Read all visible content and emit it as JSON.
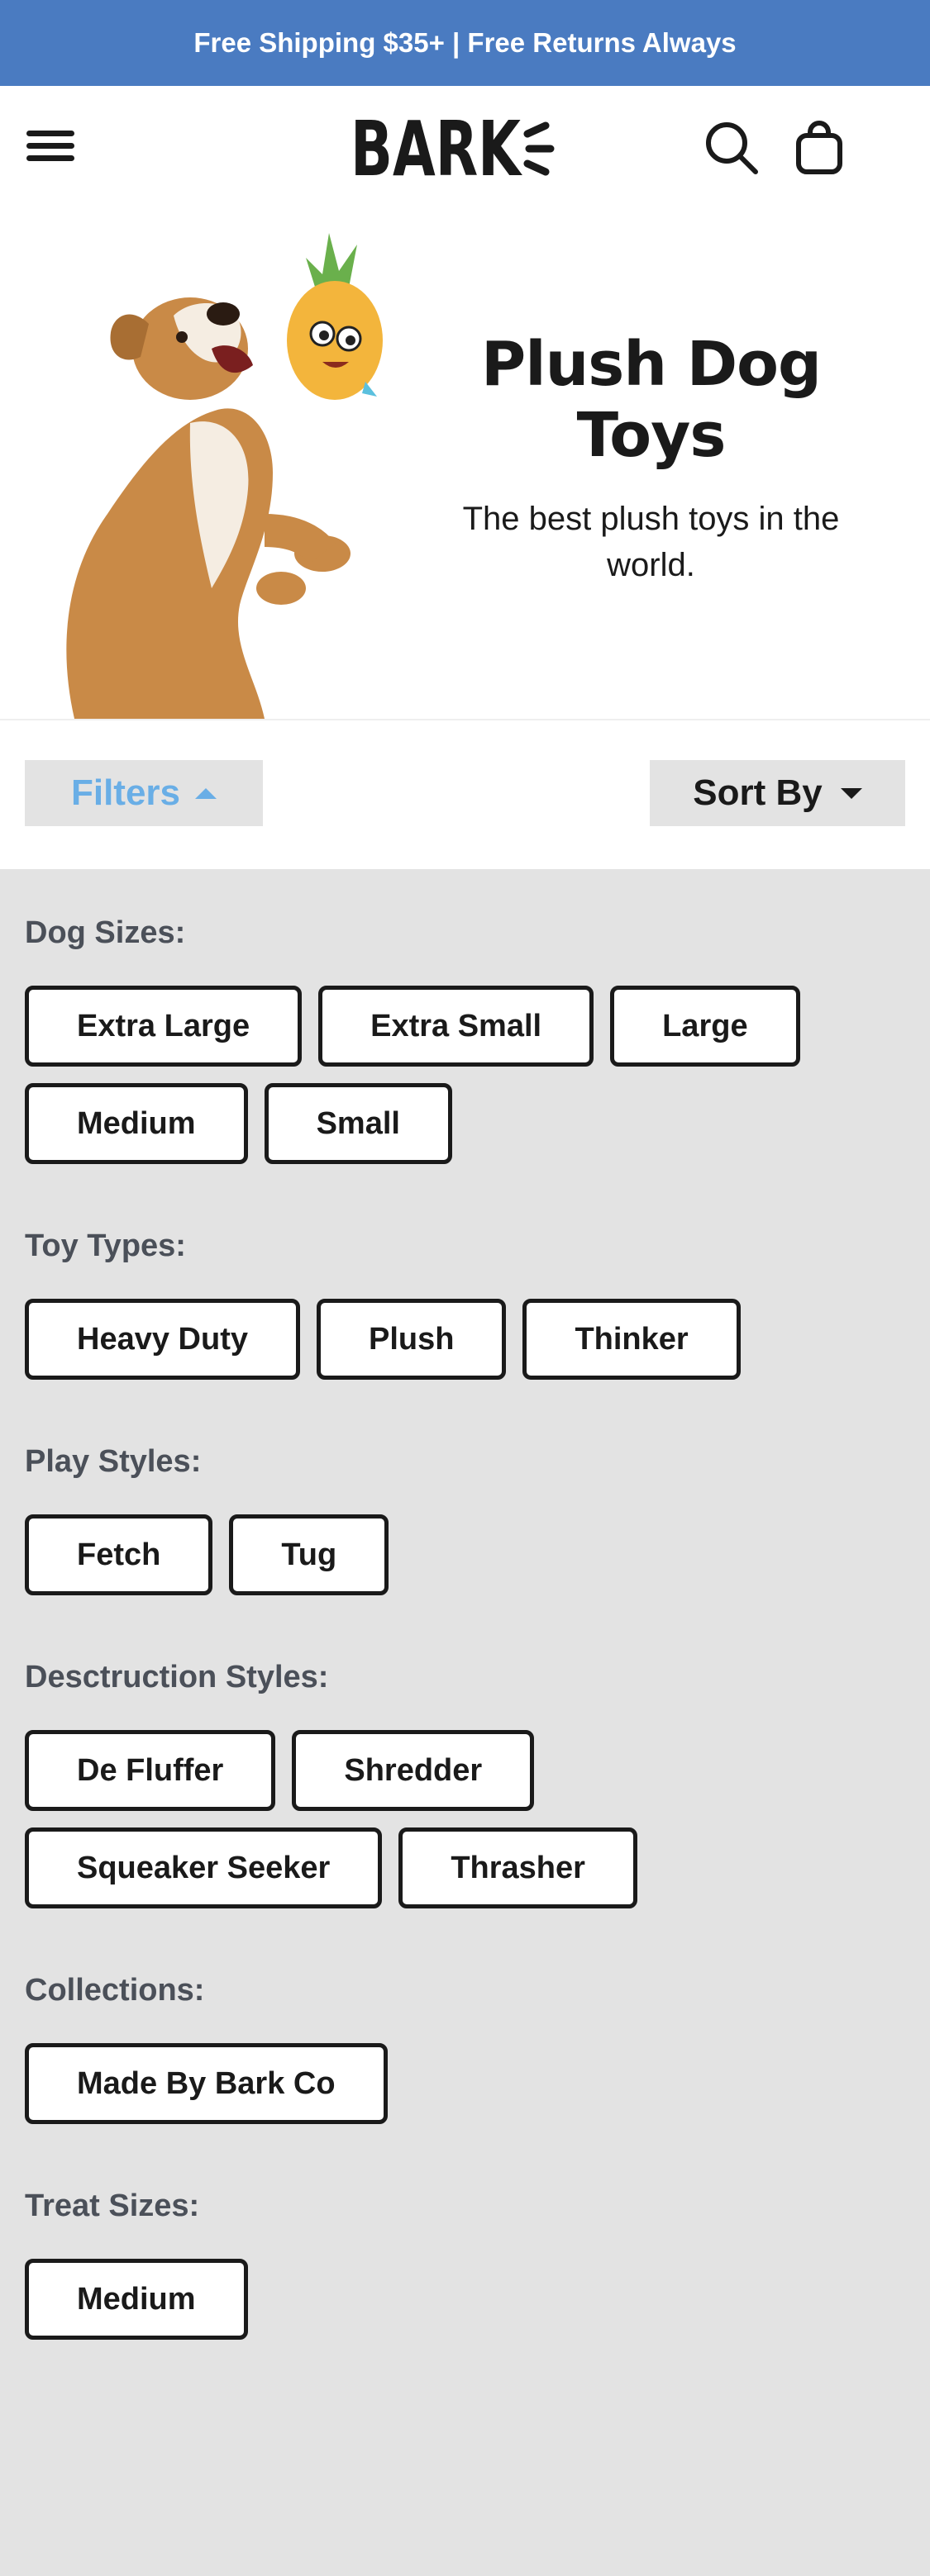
{
  "promo": {
    "text": "Free Shipping $35+ | Free Returns Always"
  },
  "header": {
    "logo_text": "BARK"
  },
  "hero": {
    "title_line1": "Plush Dog",
    "title_line2": "Toys",
    "subtitle_line1": "The best plush toys in the",
    "subtitle_line2": "world."
  },
  "controls": {
    "filters_label": "Filters",
    "sort_label": "Sort By"
  },
  "filters": {
    "groups": [
      {
        "title": "Dog Sizes:",
        "options": [
          "Extra Large",
          "Extra Small",
          "Large",
          "Medium",
          "Small"
        ]
      },
      {
        "title": "Toy Types:",
        "options": [
          "Heavy Duty",
          "Plush",
          "Thinker"
        ]
      },
      {
        "title": "Play Styles:",
        "options": [
          "Fetch",
          "Tug"
        ]
      },
      {
        "title": "Desctruction Styles:",
        "options": [
          "De Fluffer",
          "Shredder",
          "Squeaker Seeker",
          "Thrasher"
        ]
      },
      {
        "title": "Collections:",
        "options": [
          "Made By Bark Co"
        ]
      },
      {
        "title": "Treat Sizes:",
        "options": [
          "Medium"
        ]
      }
    ]
  },
  "colors": {
    "promo_bg": "#4a7bc1",
    "filters_accent": "#69aee6",
    "panel_bg": "#e3e3e3"
  }
}
